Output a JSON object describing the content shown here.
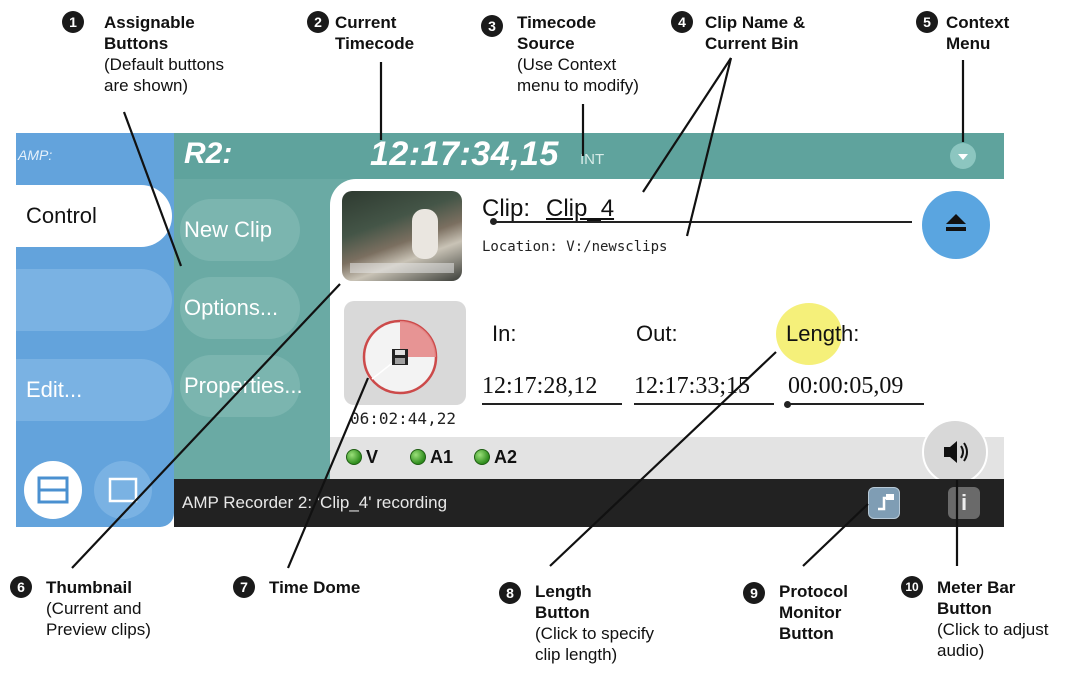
{
  "callouts": [
    {
      "num": "1",
      "title": [
        "Assignable",
        "Buttons"
      ],
      "sub": [
        "(Default buttons",
        "are shown)"
      ]
    },
    {
      "num": "2",
      "title": [
        "Current",
        "Timecode"
      ],
      "sub": []
    },
    {
      "num": "3",
      "title": [
        "Timecode",
        "Source"
      ],
      "sub": [
        "(Use Context",
        "menu to modify)"
      ]
    },
    {
      "num": "4",
      "title": [
        "Clip Name &",
        "Current Bin"
      ],
      "sub": []
    },
    {
      "num": "5",
      "title": [
        "Context",
        "Menu"
      ],
      "sub": []
    },
    {
      "num": "6",
      "title": [
        "Thumbnail"
      ],
      "sub": [
        "(Current and",
        "Preview clips)"
      ]
    },
    {
      "num": "7",
      "title": [
        "Time Dome"
      ],
      "sub": []
    },
    {
      "num": "8",
      "title": [
        "Length",
        "Button"
      ],
      "sub": [
        "(Click to specify",
        "clip length)"
      ]
    },
    {
      "num": "9",
      "title": [
        "Protocol",
        "Monitor",
        "Button"
      ],
      "sub": []
    },
    {
      "num": "10",
      "title": [
        "Meter Bar",
        "Button"
      ],
      "sub": [
        "(Click to adjust",
        "audio)"
      ]
    }
  ],
  "app": {
    "brand": "AMP:",
    "tabs": [
      "Control",
      "",
      "Edit..."
    ],
    "recorder_id": "R2:",
    "current_timecode": "12:17:34,15",
    "timecode_source": "INT",
    "assignable_buttons": [
      "New Clip",
      "Options...",
      "Properties..."
    ],
    "clip_label": "Clip:",
    "clip_name": "Clip_4",
    "location": "Location: V:/newsclips",
    "time_dome_value": "06:02:44,22",
    "time_dome_fraction": 0.25,
    "in_label": "In:",
    "out_label": "Out:",
    "length_label": "Length:",
    "in_value": "12:17:28,12",
    "out_value": "12:17:33;15",
    "length_value": "00:00:05,09",
    "channels": [
      "V",
      "A1",
      "A2"
    ],
    "status_text": "AMP Recorder 2: 'Clip_4' recording",
    "info_glyph": "i"
  },
  "colors": {
    "rail_blue": "#63a3dc",
    "main_teal": "#6aaaa4",
    "eject_blue": "#5aa5e0",
    "length_highlight": "#f5f07a",
    "dome_red": "#e07070",
    "led_green": "#3ea52a"
  },
  "icons": [
    "context-menu-icon",
    "eject-icon",
    "save-disk-icon",
    "speaker-icon",
    "protocol-monitor-icon",
    "info-icon",
    "list-view-icon",
    "single-view-icon"
  ]
}
